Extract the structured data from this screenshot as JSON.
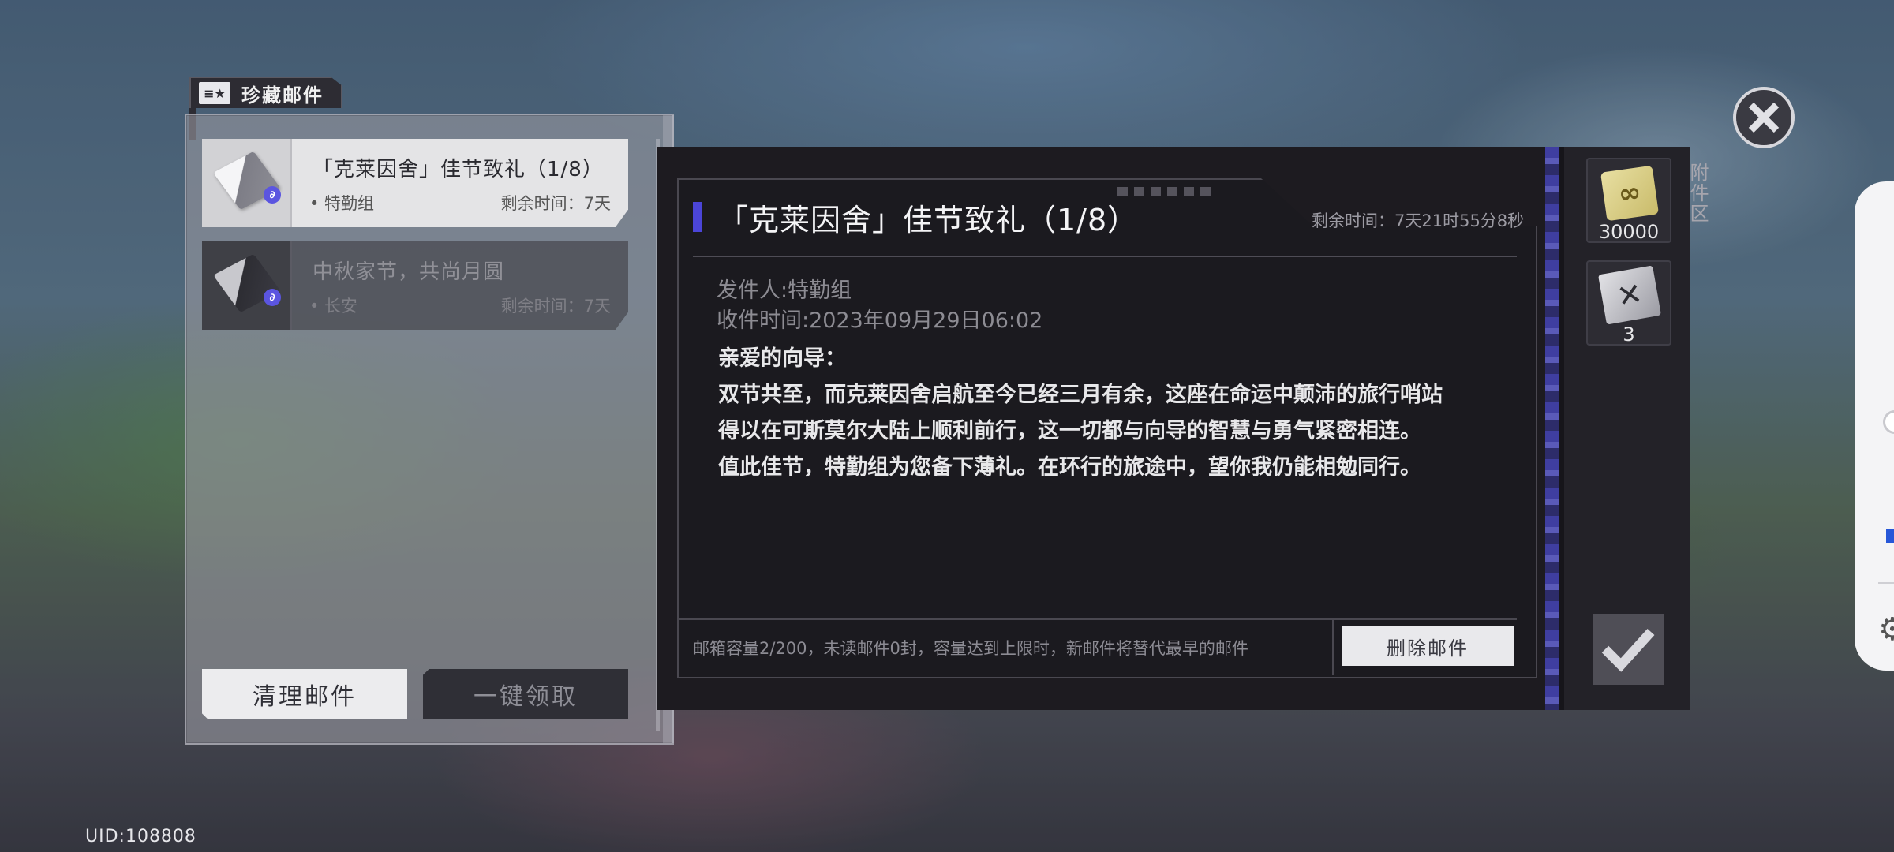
{
  "tab": {
    "label": "珍藏邮件",
    "icon": "mail-star-icon"
  },
  "mail_list": [
    {
      "title": "「克莱因舍」佳节致礼（1/8）",
      "sender": "• 特勤组",
      "time_left": "剩余时间：7天",
      "selected": true
    },
    {
      "title": "中秋家节，共尚月圆",
      "sender": "• 长安",
      "time_left": "剩余时间：7天",
      "selected": false
    }
  ],
  "actions": {
    "clean_label": "清理邮件",
    "claim_all_label": "一键领取"
  },
  "detail": {
    "title": "「克莱因舍」佳节致礼（1/8）",
    "remaining": "剩余时间：7天21时55分8秒",
    "sender_line": "发件人:特勤组",
    "received_line": "收件时间:2023年09月29日06:02",
    "body": [
      "亲爱的向导：",
      "双节共至，而克莱因舍启航至今已经三月有余，这座在命运中颠沛的旅行哨站",
      "得以在可斯莫尔大陆上顺利前行，这一切都与向导的智慧与勇气紧密相连。",
      "值此佳节，特勤组为您备下薄礼。在环行的旅途中，望你我仍能相勉同行。"
    ],
    "capacity_text": "邮箱容量2/200，未读邮件0封，容量达到上限时，新邮件将替代最早的邮件",
    "delete_label": "删除邮件"
  },
  "attachments": {
    "label": "附件区",
    "items": [
      {
        "icon": "infinity-chip-icon",
        "count": "30000"
      },
      {
        "icon": "crossed-blade-icon",
        "count": "3"
      }
    ]
  },
  "uid": "UID:108808",
  "colors": {
    "accent": "#4b45d8",
    "panel_dark": "#1d1b20",
    "selected_item": "#e4e4e6"
  }
}
